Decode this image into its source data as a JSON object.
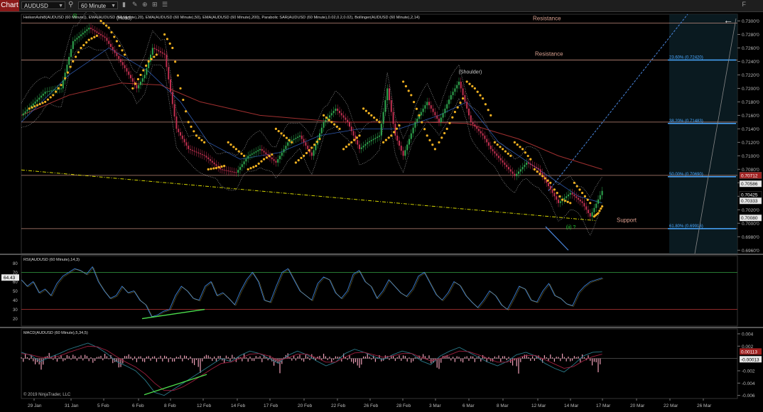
{
  "toolbar": {
    "chart_tab": "Chart",
    "instrument": "AUDUSD",
    "interval": "60 Minute",
    "panel_button": "F"
  },
  "colors": {
    "background": "#000000",
    "candle_up": "#2fa84f",
    "candle_down": "#c03050",
    "sar": "#f0b020",
    "ema20": "#3a6fd8",
    "ema50": "#8a6ab0",
    "ema200": "#a03030",
    "trendline": "#d4d400",
    "fib": "#4aa8ff",
    "resistance": "#e0a090"
  },
  "chart_data": [
    {
      "type": "line",
      "panel": "price",
      "indicator_caption": "HeikenAshi8(AUDUSD (60 Minute)), EMA(AUDUSD (60 Minute),20), EMA(AUDUSD (60 Minute),50), EMA(AUDUSD (60 Minute),200), Parabolic SAR(AUDUSD (60 Minute),0.02,0.2,0.02), Bollinger(AUDUSD (60 Minute),2,14)",
      "x_ticks": [
        "29 Jan",
        "31 Jan",
        "5 Feb",
        "6 Feb",
        "8 Feb",
        "12 Feb",
        "14 Feb",
        "17 Feb",
        "20 Feb",
        "22 Feb",
        "26 Feb",
        "28 Feb",
        "3 Mar",
        "6 Mar",
        "8 Mar",
        "12 Mar",
        "14 Mar",
        "17 Mar",
        "20 Mar",
        "22 Mar",
        "26 Mar"
      ],
      "y_ticks": [
        "0.7300'0",
        "0.7280'0",
        "0.7260'0",
        "0.7240'0",
        "0.7220'0",
        "0.7200'0",
        "0.7180'0",
        "0.7160'0",
        "0.7140'0",
        "0.7120'0",
        "0.7100'0",
        "0.7080'0",
        "0.7060'0",
        "0.7040'0",
        "0.7020'0",
        "0.7000'0",
        "0.6980'0",
        "0.6960'0"
      ],
      "ylim": [
        0.6955,
        0.731
      ],
      "price_path": [
        [
          0,
          0.716
        ],
        [
          6,
          0.7195
        ],
        [
          10,
          0.72
        ],
        [
          13,
          0.727
        ],
        [
          17,
          0.729
        ],
        [
          21,
          0.7275
        ],
        [
          26,
          0.723
        ],
        [
          29,
          0.72
        ],
        [
          31,
          0.722
        ],
        [
          33,
          0.726
        ],
        [
          36,
          0.725
        ],
        [
          39,
          0.714
        ],
        [
          42,
          0.711
        ],
        [
          46,
          0.71
        ],
        [
          50,
          0.708
        ],
        [
          54,
          0.7075
        ],
        [
          57,
          0.71
        ],
        [
          60,
          0.711
        ],
        [
          64,
          0.709
        ],
        [
          67,
          0.712
        ],
        [
          70,
          0.713
        ],
        [
          73,
          0.71
        ],
        [
          76,
          0.715
        ],
        [
          79,
          0.717
        ],
        [
          82,
          0.715
        ],
        [
          85,
          0.711
        ],
        [
          87,
          0.712
        ],
        [
          90,
          0.713
        ],
        [
          92,
          0.72
        ],
        [
          94,
          0.713
        ],
        [
          96,
          0.71
        ],
        [
          99,
          0.715
        ],
        [
          102,
          0.718
        ],
        [
          105,
          0.715
        ],
        [
          108,
          0.719
        ],
        [
          110,
          0.721
        ],
        [
          113,
          0.715
        ],
        [
          116,
          0.713
        ],
        [
          118,
          0.711
        ],
        [
          121,
          0.709
        ],
        [
          124,
          0.707
        ],
        [
          127,
          0.709
        ],
        [
          130,
          0.708
        ],
        [
          132,
          0.706
        ],
        [
          135,
          0.703
        ],
        [
          138,
          0.7045
        ],
        [
          141,
          0.703
        ],
        [
          143,
          0.701
        ],
        [
          146,
          0.7048
        ]
      ],
      "ema200_path": [
        [
          0,
          0.716
        ],
        [
          12,
          0.719
        ],
        [
          25,
          0.7208
        ],
        [
          35,
          0.7205
        ],
        [
          45,
          0.718
        ],
        [
          60,
          0.716
        ],
        [
          80,
          0.715
        ],
        [
          100,
          0.715
        ],
        [
          112,
          0.7148
        ],
        [
          125,
          0.7125
        ],
        [
          135,
          0.71
        ],
        [
          146,
          0.708
        ]
      ],
      "ema20_path": [
        [
          0,
          0.715
        ],
        [
          12,
          0.722
        ],
        [
          22,
          0.726
        ],
        [
          32,
          0.7225
        ],
        [
          40,
          0.718
        ],
        [
          47,
          0.712
        ],
        [
          55,
          0.7095
        ],
        [
          65,
          0.7105
        ],
        [
          75,
          0.713
        ],
        [
          85,
          0.714
        ],
        [
          95,
          0.714
        ],
        [
          105,
          0.716
        ],
        [
          112,
          0.718
        ],
        [
          120,
          0.712
        ],
        [
          130,
          0.708
        ],
        [
          140,
          0.704
        ],
        [
          146,
          0.703
        ]
      ],
      "sar_segments": [
        [
          [
            2,
            0.717
          ],
          [
            4,
            0.7175
          ],
          [
            6,
            0.718
          ],
          [
            8,
            0.719
          ],
          [
            10,
            0.7205
          ]
        ],
        [
          [
            11,
            0.7215
          ],
          [
            13,
            0.724
          ],
          [
            15,
            0.726
          ],
          [
            17,
            0.7272
          ],
          [
            19,
            0.7278
          ]
        ],
        [
          [
            20,
            0.73
          ],
          [
            22,
            0.729
          ],
          [
            24,
            0.727
          ],
          [
            26,
            0.725
          ]
        ],
        [
          [
            28,
            0.72
          ],
          [
            30,
            0.722
          ],
          [
            32,
            0.724
          ],
          [
            34,
            0.725
          ]
        ],
        [
          [
            36,
            0.728
          ],
          [
            38,
            0.726
          ],
          [
            40,
            0.72
          ],
          [
            42,
            0.715
          ],
          [
            44,
            0.713
          ],
          [
            46,
            0.712
          ]
        ],
        [
          [
            47,
            0.708
          ],
          [
            49,
            0.7082
          ],
          [
            51,
            0.7085
          ]
        ],
        [
          [
            52,
            0.712
          ],
          [
            54,
            0.711
          ],
          [
            56,
            0.71
          ]
        ],
        [
          [
            57,
            0.708
          ],
          [
            59,
            0.7085
          ],
          [
            61,
            0.7095
          ],
          [
            63,
            0.7102
          ]
        ],
        [
          [
            64,
            0.714
          ],
          [
            66,
            0.713
          ],
          [
            68,
            0.712
          ]
        ],
        [
          [
            69,
            0.709
          ],
          [
            71,
            0.71
          ],
          [
            73,
            0.7112
          ],
          [
            75,
            0.7125
          ]
        ],
        [
          [
            76,
            0.716
          ],
          [
            78,
            0.715
          ],
          [
            80,
            0.714
          ]
        ],
        [
          [
            81,
            0.711
          ],
          [
            83,
            0.712
          ],
          [
            85,
            0.713
          ]
        ],
        [
          [
            86,
            0.717
          ],
          [
            88,
            0.716
          ],
          [
            90,
            0.715
          ]
        ],
        [
          [
            91,
            0.712
          ],
          [
            93,
            0.713
          ],
          [
            95,
            0.7145
          ]
        ],
        [
          [
            96,
            0.721
          ],
          [
            98,
            0.719
          ],
          [
            100,
            0.716
          ],
          [
            102,
            0.713
          ],
          [
            104,
            0.711
          ]
        ],
        [
          [
            105,
            0.712
          ],
          [
            107,
            0.714
          ],
          [
            109,
            0.7165
          ],
          [
            111,
            0.7185
          ]
        ],
        [
          [
            112,
            0.721
          ],
          [
            114,
            0.72
          ],
          [
            116,
            0.7185
          ],
          [
            118,
            0.716
          ]
        ],
        [
          [
            119,
            0.712
          ],
          [
            121,
            0.711
          ],
          [
            123,
            0.71
          ]
        ],
        [
          [
            124,
            0.712
          ],
          [
            126,
            0.711
          ],
          [
            128,
            0.7095
          ]
        ],
        [
          [
            129,
            0.708
          ],
          [
            131,
            0.707
          ],
          [
            133,
            0.706
          ]
        ],
        [
          [
            134,
            0.705
          ],
          [
            136,
            0.7035
          ],
          [
            138,
            0.703
          ]
        ],
        [
          [
            139,
            0.706
          ],
          [
            141,
            0.7045
          ],
          [
            143,
            0.703
          ]
        ],
        [
          [
            144,
            0.701
          ],
          [
            145,
            0.7015
          ],
          [
            146,
            0.7025
          ]
        ]
      ],
      "horizontal_levels": [
        {
          "label": "Resistance",
          "price": 0.7297,
          "color": "#e0a090"
        },
        {
          "label": "Resistance",
          "price": 0.7242,
          "color": "#e0a090"
        },
        {
          "label": "",
          "price": 0.715,
          "color": "#e0a090"
        },
        {
          "label": "",
          "price": 0.7071,
          "color": "#e0a090"
        },
        {
          "label": "",
          "price": 0.6992,
          "color": "#e0a090"
        }
      ],
      "fib_levels": [
        {
          "label": "23.60% (0.72420)",
          "price": 0.7242
        },
        {
          "label": "38.20% (0.71483)",
          "price": 0.7148
        },
        {
          "label": "50.00% (0.70690)",
          "price": 0.7069
        },
        {
          "label": "61.80% (0.69916)",
          "price": 0.6992
        }
      ],
      "annotations": [
        {
          "text": "(Head)",
          "x": 25,
          "price": 0.7302,
          "color": "#cccccc"
        },
        {
          "text": "(i)",
          "x": 14,
          "price": 0.7305,
          "color": "#22cc33"
        },
        {
          "text": "(Shoulder)",
          "x": 111,
          "price": 0.7222,
          "color": "#cccccc"
        },
        {
          "text": "Support",
          "x": 170,
          "price": 0.7004,
          "color": "#e0a090"
        },
        {
          "text": "(ii) ?",
          "x": 138,
          "price": 0.6992,
          "color": "#22cc33"
        }
      ],
      "price_labels": [
        {
          "text": "0.70712",
          "price": 0.7071,
          "bg": "#a02020",
          "fg": "#ffffff"
        },
        {
          "text": "0.70586",
          "price": 0.70586,
          "bg": "#e8e8e8",
          "fg": "#000000"
        },
        {
          "text": "0.70425",
          "price": 0.70425,
          "bg": "#000000",
          "fg": "#ffffff"
        },
        {
          "text": "0.70333",
          "price": 0.70333,
          "bg": "#e8e8e8",
          "fg": "#000000"
        },
        {
          "text": "0.70080",
          "price": 0.7008,
          "bg": "#e8e8e8",
          "fg": "#000000"
        }
      ]
    },
    {
      "type": "line",
      "panel": "rsi",
      "title": "RSI(AUDUSD (60 Minute),14,3)",
      "y_ticks": [
        "80",
        "70",
        "60",
        "50",
        "40",
        "30",
        "20"
      ],
      "ylim": [
        12,
        88
      ],
      "levels": [
        70,
        30
      ],
      "current_label": "64.43",
      "values": [
        62,
        55,
        60,
        48,
        52,
        45,
        58,
        66,
        70,
        74,
        72,
        68,
        76,
        60,
        50,
        42,
        45,
        55,
        48,
        50,
        40,
        35,
        22,
        24,
        28,
        30,
        45,
        55,
        50,
        42,
        40,
        55,
        60,
        45,
        48,
        42,
        35,
        50,
        62,
        70,
        60,
        40,
        38,
        55,
        70,
        74,
        62,
        50,
        45,
        40,
        58,
        65,
        62,
        48,
        42,
        50,
        68,
        72,
        60,
        55,
        42,
        50,
        62,
        55,
        48,
        44,
        52,
        66,
        70,
        58,
        46,
        40,
        48,
        60,
        56,
        45,
        38,
        32,
        40,
        50,
        45,
        35,
        30,
        42,
        55,
        52,
        40,
        38,
        50,
        58,
        45,
        42,
        36,
        34,
        48,
        55,
        60,
        62,
        64
      ]
    },
    {
      "type": "line",
      "panel": "macd",
      "title": "MACD(AUDUSD (60 Minute),5,34,5)",
      "y_ticks": [
        "0.004",
        "0.002",
        "-0.002",
        "-0.004",
        "-0.006"
      ],
      "ylim": [
        -0.0065,
        0.0048
      ],
      "current_labels": [
        {
          "text": "0.00113",
          "value": 0.00113,
          "bg": "#a02020",
          "fg": "#ffffff"
        },
        {
          "text": "-0.00013",
          "value": -0.00013,
          "bg": "#e8e8e8",
          "fg": "#000000"
        }
      ],
      "macd": [
        0.001,
        0.0005,
        -0.0005,
        0.0002,
        0.0008,
        0.0015,
        0.002,
        0.0025,
        0.0018,
        0.0008,
        -0.0005,
        -0.0012,
        -0.002,
        -0.0035,
        -0.0055,
        -0.006,
        -0.005,
        -0.004,
        -0.003,
        -0.002,
        -0.001,
        0.0,
        -0.0005,
        0.0005,
        0.0012,
        0.0008,
        0.0,
        -0.0008,
        0.0005,
        0.0012,
        0.0006,
        -0.0004,
        -0.0012,
        -0.0006,
        0.0008,
        0.0015,
        0.001,
        0.0003,
        -0.0002,
        0.0006,
        0.0012,
        0.0008,
        -0.0004,
        -0.001,
        0.0004,
        0.0012,
        0.0018,
        0.001,
        0.0002,
        -0.0006,
        -0.0012,
        -0.0005,
        0.0006,
        0.001,
        0.0004,
        -0.0008,
        -0.0016,
        -0.0022,
        -0.001,
        0.0004,
        0.001,
        0.0011
      ],
      "signal": [
        0.0008,
        0.0006,
        0.0002,
        0.0001,
        0.0004,
        0.001,
        0.0015,
        0.002,
        0.0019,
        0.0013,
        0.0003,
        -0.0006,
        -0.0014,
        -0.0025,
        -0.004,
        -0.0052,
        -0.0052,
        -0.0046,
        -0.0037,
        -0.0027,
        -0.0017,
        -0.0008,
        -0.0006,
        0.0,
        0.0007,
        0.0008,
        0.0004,
        -0.0003,
        0.0001,
        0.0007,
        0.0007,
        0.0001,
        -0.0006,
        -0.0006,
        0.0002,
        0.0009,
        0.001,
        0.0006,
        0.0002,
        0.0004,
        0.0008,
        0.0008,
        0.0002,
        -0.0004,
        0.0,
        0.0006,
        0.0012,
        0.0011,
        0.0006,
        0.0,
        -0.0006,
        -0.0006,
        0.0,
        0.0005,
        0.0005,
        -0.0002,
        -0.0009,
        -0.0016,
        -0.0013,
        -0.0004,
        0.0003,
        0.0007
      ],
      "histogram_spikes": [
        0.0005,
        -0.0006,
        0.0008,
        0.0004,
        -0.0003,
        0.0006,
        -0.0008,
        -0.0012,
        -0.0006,
        -0.0015,
        -0.0025,
        -0.001,
        0.0004,
        0.0006,
        0.0009,
        0.0003,
        -0.0004,
        0.0005,
        -0.0006,
        0.0004,
        0.0006,
        -0.0005,
        -0.0007,
        0.0006,
        0.0004,
        -0.0004,
        0.0007,
        0.0004,
        -0.0006,
        0.0003,
        0.0005,
        -0.0005,
        0.0008,
        0.0004,
        -0.0006,
        0.0003,
        -0.0007,
        -0.0005,
        0.0004,
        0.0003
      ]
    }
  ],
  "copyright": "© 2019 NinjaTrader, LLC"
}
